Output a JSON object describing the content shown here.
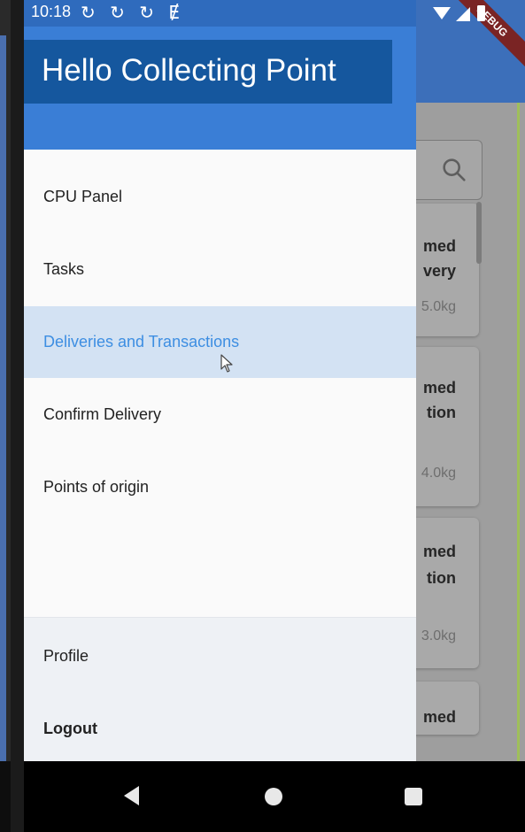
{
  "status_bar": {
    "time": "10:18",
    "notification_icons": "↻ ↻ ↻ Ɇ"
  },
  "debug_banner": "DEBUG",
  "drawer": {
    "title": "Hello Collecting Point",
    "menu": [
      {
        "label": "CPU Panel",
        "selected": false
      },
      {
        "label": "Tasks",
        "selected": false
      },
      {
        "label": "Deliveries and Transactions",
        "selected": true
      },
      {
        "label": "Confirm Delivery",
        "selected": false
      },
      {
        "label": "Points of origin",
        "selected": false
      }
    ],
    "footer": [
      {
        "label": "Profile"
      },
      {
        "label": "Logout"
      }
    ]
  },
  "background_cards": [
    {
      "line1": "med",
      "line2": "very",
      "weight": "5.0kg"
    },
    {
      "line1": "med",
      "line2": "tion",
      "weight": "4.0kg"
    },
    {
      "line1": "med",
      "line2": "tion",
      "weight": "3.0kg"
    },
    {
      "line1": "med"
    }
  ],
  "icons": {
    "search": "search-icon",
    "back": "back-triangle-icon",
    "home": "home-circle-icon",
    "recents": "recents-square-icon",
    "cursor": "mouse-pointer-icon"
  },
  "colors": {
    "drawer_header": "#3a7ed6",
    "title_box": "#15579e",
    "selected_bg": "#d3e2f3",
    "selected_text": "#3d8ee2"
  }
}
